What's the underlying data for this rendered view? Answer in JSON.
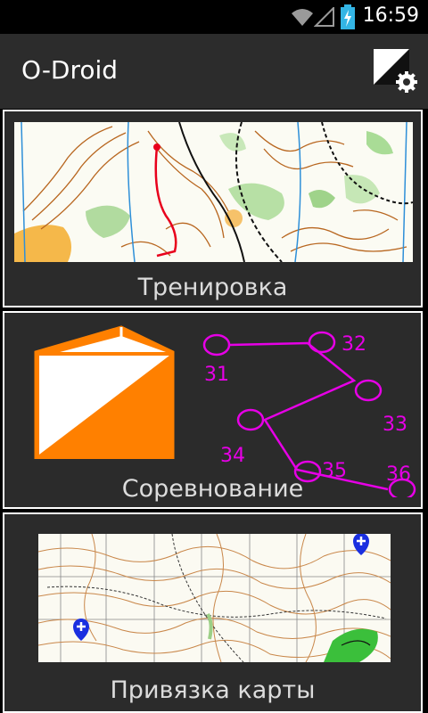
{
  "status_bar": {
    "time": "16:59",
    "icons": [
      "wifi-icon",
      "signal-icon",
      "battery-charging-icon"
    ]
  },
  "action_bar": {
    "title": "O-Droid",
    "settings_icon": "map-settings-icon"
  },
  "cards": [
    {
      "label": "Тренировка",
      "image": "orienteering-map-route"
    },
    {
      "label": "Соревнование",
      "image": "control-flag-and-course"
    },
    {
      "label": "Привязка карты",
      "image": "map-with-markers"
    }
  ],
  "course_controls": [
    "31",
    "32",
    "33",
    "34",
    "35",
    "36"
  ],
  "colors": {
    "accent_orange": "#ff8000",
    "course_magenta": "#e600e6",
    "marker_blue": "#1a2fe0",
    "card_bg": "#2b2b2b",
    "actionbar_bg": "#2c2c2c"
  }
}
